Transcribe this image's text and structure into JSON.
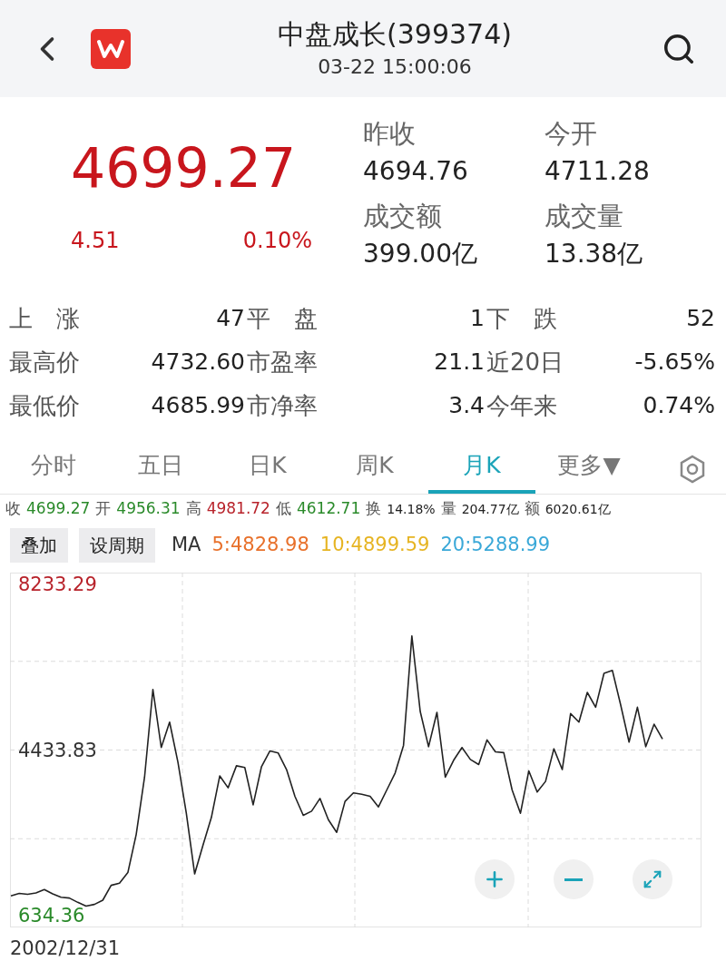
{
  "header": {
    "title": "中盘成长(399374)",
    "time": "03-22 15:00:06"
  },
  "quote": {
    "price": "4699.27",
    "change": "4.51",
    "change_pct": "0.10%",
    "color": "#c8161d"
  },
  "quote_fields": [
    {
      "label": "昨收",
      "value": "4694.76"
    },
    {
      "label": "今开",
      "value": "4711.28"
    },
    {
      "label": "成交额",
      "value": "399.00亿"
    },
    {
      "label": "成交量",
      "value": "13.38亿"
    }
  ],
  "stats": [
    [
      {
        "label": "上　涨",
        "value": "47"
      },
      {
        "label": "平　盘",
        "value": "1"
      },
      {
        "label": "下　跌",
        "value": "52"
      }
    ],
    [
      {
        "label": "最高价",
        "value": "4732.60"
      },
      {
        "label": "市盈率",
        "value": "21.1"
      },
      {
        "label": "近20日",
        "value": "-5.65%"
      }
    ],
    [
      {
        "label": "最低价",
        "value": "4685.99"
      },
      {
        "label": "市净率",
        "value": "3.4"
      },
      {
        "label": "今年来",
        "value": "0.74%"
      }
    ]
  ],
  "tabs": [
    {
      "label": "分时",
      "selected": false
    },
    {
      "label": "五日",
      "selected": false
    },
    {
      "label": "日K",
      "selected": false
    },
    {
      "label": "周K",
      "selected": false
    },
    {
      "label": "月K",
      "selected": true
    },
    {
      "label": "更多▼",
      "selected": false
    }
  ],
  "ohlc": [
    {
      "label": "收",
      "value": "4699.27",
      "color": "#2a8a2a"
    },
    {
      "label": "开",
      "value": "4956.31",
      "color": "#2a8a2a"
    },
    {
      "label": "高",
      "value": "4981.72",
      "color": "#b8232b"
    },
    {
      "label": "低",
      "value": "4612.71",
      "color": "#2a8a2a"
    },
    {
      "label": "换",
      "value": "14.18%",
      "color": "#222222"
    },
    {
      "label": "量",
      "value": "204.77亿",
      "color": "#222222"
    },
    {
      "label": "额",
      "value": "6020.61亿",
      "color": "#222222"
    }
  ],
  "chart_toolbar": {
    "buttons": [
      "叠加",
      "设周期"
    ],
    "ma_label": "MA",
    "ma": [
      {
        "text": "5:4828.98",
        "color": "#e8702a"
      },
      {
        "text": "10:4899.59",
        "color": "#e6b422"
      },
      {
        "text": "20:5288.99",
        "color": "#3aa8d8"
      }
    ]
  },
  "chart": {
    "chart_data": {
      "type": "line",
      "ylim": [
        370,
        8500
      ],
      "grid": true,
      "yticks": [
        {
          "value": 8233.29,
          "label": "8233.29"
        },
        {
          "value": 4433.83,
          "label": "4433.83"
        },
        {
          "value": 634.36,
          "label": "634.36"
        }
      ],
      "series": [
        {
          "color": "#222222",
          "values": [
            1091,
            1150,
            1130,
            1159,
            1237,
            1140,
            1062,
            1043,
            945,
            858,
            897,
            994,
            1334,
            1383,
            1626,
            2500,
            3812,
            5823,
            4492,
            5075,
            4152,
            2986,
            1596,
            2257,
            2889,
            3841,
            3569,
            4074,
            4035,
            3180,
            4055,
            4414,
            4366,
            3987,
            3375,
            2937,
            3034,
            3326,
            2840,
            2549,
            3258,
            3452,
            3423,
            3375,
            3132,
            3520,
            3909,
            4541,
            7048,
            5318,
            4511,
            5299,
            3812,
            4200,
            4492,
            4220,
            4103,
            4667,
            4395,
            4375,
            3520,
            2986,
            3958,
            3472,
            3715,
            4463,
            3987,
            5269,
            5075,
            5755,
            5415,
            6192,
            6260,
            5464,
            4618,
            5415,
            4511,
            5026,
            4686
          ]
        }
      ]
    },
    "start_date": "2002/12/31"
  }
}
